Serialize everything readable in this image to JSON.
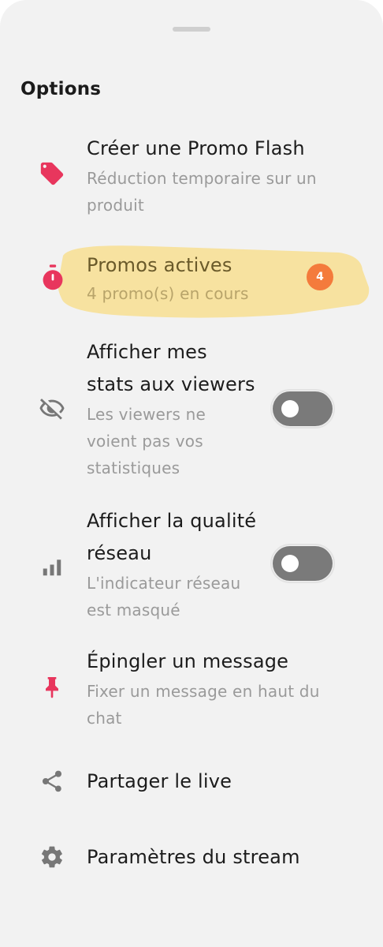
{
  "sheet": {
    "title": "Options"
  },
  "items": [
    {
      "label": "Créer une Promo Flash",
      "sublabel_lines": [
        "Réduction temporaire sur un",
        "produit"
      ],
      "icon": "tag-icon",
      "icon_color": "#e8365d"
    },
    {
      "label": "Promos actives",
      "sublabel_lines": [
        "4 promo(s) en cours"
      ],
      "icon": "stopwatch-icon",
      "icon_color": "#e8365d",
      "badge": "4",
      "badge_color": "#f47b3c",
      "highlight_color": "#f7e199"
    },
    {
      "label_lines": [
        "Afficher mes",
        "stats aux viewers"
      ],
      "sublabel_lines": [
        "Les viewers ne",
        "voient pas vos",
        "statistiques"
      ],
      "icon": "eye-off-icon",
      "icon_color": "#777777",
      "toggle": false
    },
    {
      "label_lines": [
        "Afficher la qualité",
        "réseau"
      ],
      "sublabel_lines": [
        "L'indicateur réseau",
        "est masqué"
      ],
      "icon": "signal-bars-icon",
      "icon_color": "#777777",
      "toggle": false
    },
    {
      "label": "Épingler un message",
      "sublabel_lines": [
        "Fixer un message en haut du",
        "chat"
      ],
      "icon": "pin-icon",
      "icon_color": "#e8365d"
    },
    {
      "label": "Partager le live",
      "icon": "share-icon",
      "icon_color": "#777777"
    },
    {
      "label": "Paramètres du stream",
      "icon": "gear-icon",
      "icon_color": "#777777"
    }
  ],
  "colors": {
    "sheet_background": "#f2f2f2",
    "accent": "#e8365d",
    "toggle_off": "#7a7a7a"
  }
}
